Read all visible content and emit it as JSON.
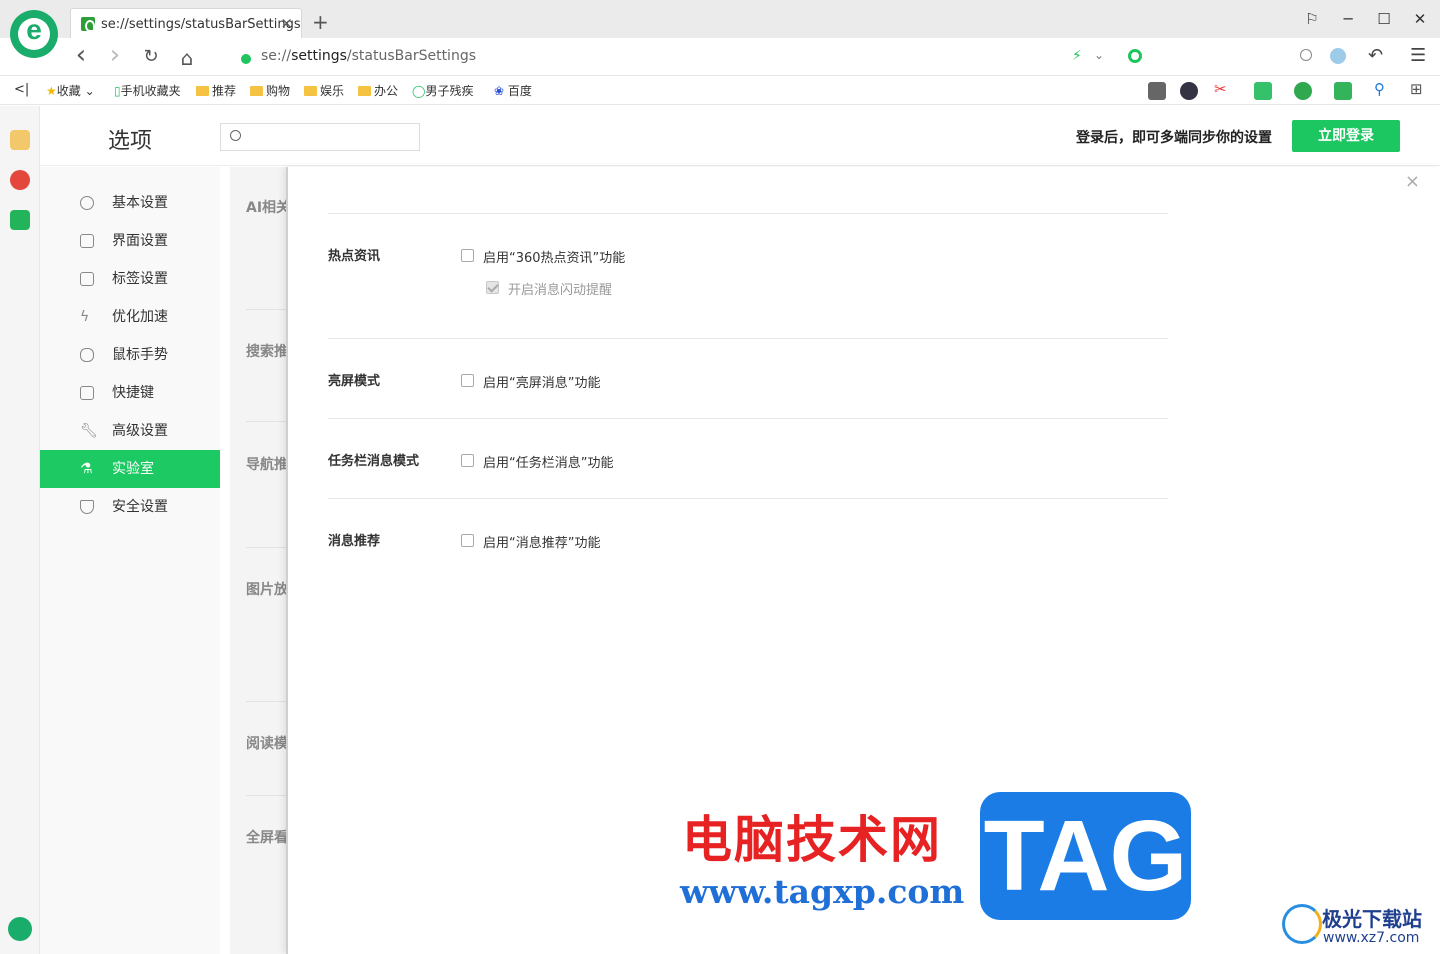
{
  "browser": {
    "logo_letter": "e",
    "tab_title": "se://settings/statusBarSettings",
    "tab_close": "×",
    "new_tab": "+",
    "window": {
      "min": "─",
      "max": "☐",
      "close": "✕",
      "skin": "⚐"
    },
    "url_prefix": "se://",
    "url_bold": "settings",
    "url_suffix": "/statusBarSettings",
    "nav": {
      "back": "‹",
      "forward": "›",
      "reload": "↻",
      "home": "⌂"
    }
  },
  "bookmarks": [
    {
      "label": "收藏",
      "icon": "star-icon"
    },
    {
      "label": "手机收藏夹",
      "icon": "phone-icon"
    },
    {
      "label": "推荐",
      "icon": "folder-icon"
    },
    {
      "label": "购物",
      "icon": "folder-icon"
    },
    {
      "label": "娱乐",
      "icon": "folder-icon"
    },
    {
      "label": "办公",
      "icon": "folder-icon"
    },
    {
      "label": "男子残疾",
      "icon": "360-icon"
    },
    {
      "label": "百度",
      "icon": "baidu-icon"
    }
  ],
  "header": {
    "title": "选项",
    "search_placeholder": "",
    "login_msg": "登录后，即可多端同步你的设置",
    "login_btn": "立即登录"
  },
  "sidebar": [
    {
      "label": "基本设置",
      "icon": "gear-icon",
      "active": false
    },
    {
      "label": "界面设置",
      "icon": "window-icon",
      "active": false
    },
    {
      "label": "标签设置",
      "icon": "tab-icon",
      "active": false
    },
    {
      "label": "优化加速",
      "icon": "lightning-icon",
      "active": false
    },
    {
      "label": "鼠标手势",
      "icon": "mouse-icon",
      "active": false
    },
    {
      "label": "快捷键",
      "icon": "keyboard-icon",
      "active": false
    },
    {
      "label": "高级设置",
      "icon": "wrench-icon",
      "active": true,
      "label_override": null
    },
    {
      "label": "实验室",
      "icon": "flask-icon",
      "active": true
    },
    {
      "label": "安全设置",
      "icon": "shield-icon",
      "active": false
    }
  ],
  "midcol": [
    "AI相关",
    "搜索推",
    "导航推",
    "图片放",
    "阅读模",
    "全屏看"
  ],
  "panel": {
    "close": "×",
    "sections": [
      {
        "title": "热点资讯",
        "options": [
          {
            "label": "启用“360热点资讯”功能",
            "checked": false,
            "disabled": false
          },
          {
            "label": "开启消息闪动提醒",
            "checked": true,
            "disabled": true
          }
        ]
      },
      {
        "title": "亮屏模式",
        "options": [
          {
            "label": "启用“亮屏消息”功能",
            "checked": false,
            "disabled": false
          }
        ]
      },
      {
        "title": "任务栏消息模式",
        "options": [
          {
            "label": "启用“任务栏消息”功能",
            "checked": false,
            "disabled": false
          }
        ]
      },
      {
        "title": "消息推荐",
        "options": [
          {
            "label": "启用“消息推荐”功能",
            "checked": false,
            "disabled": false
          }
        ]
      }
    ]
  },
  "watermark": {
    "cn": "电脑技术网",
    "url": "www.tagxp.com",
    "tag": "TAG",
    "xz_name": "极光下载站",
    "xz_url": "www.xz7.com"
  },
  "colors": {
    "accent": "#1dc962",
    "brand": "#1aac6a"
  }
}
